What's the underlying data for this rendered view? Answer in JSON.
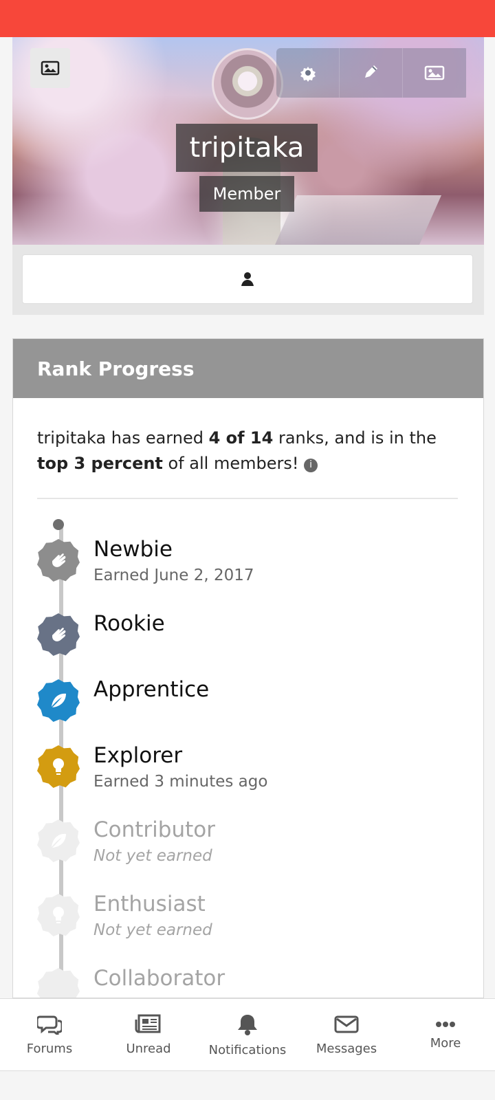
{
  "profile": {
    "name": "tripitaka",
    "group": "Member"
  },
  "rank_progress": {
    "title": "Rank Progress",
    "summary_prefix": "tripitaka has earned ",
    "earned": "4 of 14",
    "summary_mid": " ranks, and is in the ",
    "percentile": "top 3 percent",
    "summary_suffix": " of all members!"
  },
  "ranks": [
    {
      "name": "Newbie",
      "status": "Earned June 2, 2017",
      "color": "#8d8d8d"
    },
    {
      "name": "Rookie",
      "status": "",
      "color": "#687286"
    },
    {
      "name": "Apprentice",
      "status": "",
      "color": "#1f89c9"
    },
    {
      "name": "Explorer",
      "status": "Earned 3 minutes ago",
      "color": "#d39c11"
    },
    {
      "name": "Contributor",
      "status": "Not yet earned",
      "color": "#eeeeee"
    },
    {
      "name": "Enthusiast",
      "status": "Not yet earned",
      "color": "#eeeeee"
    },
    {
      "name": "Collaborator",
      "status": "",
      "color": "#eeeeee"
    }
  ],
  "bottom_nav": [
    {
      "label": "Forums",
      "icon": "comments-icon"
    },
    {
      "label": "Unread",
      "icon": "newspaper-icon"
    },
    {
      "label": "Notifications",
      "icon": "bell-icon"
    },
    {
      "label": "Messages",
      "icon": "envelope-icon"
    },
    {
      "label": "More",
      "icon": "ellipsis-icon"
    }
  ],
  "colors": {
    "top_bar": "#f7473a",
    "header": "#959595"
  }
}
